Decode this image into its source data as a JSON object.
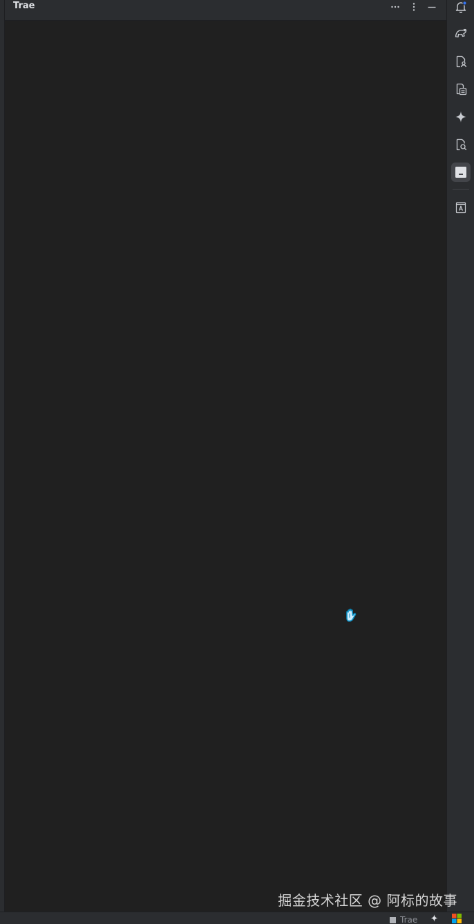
{
  "panel": {
    "title": "Trae",
    "actions": {
      "more": "⋯",
      "options": "⋮",
      "minimize": "—"
    }
  },
  "right_stripe": {
    "items": [
      {
        "icon": "notifications-bell-icon",
        "badge": true
      },
      {
        "icon": "ai-brain-icon"
      },
      {
        "icon": "user-document-icon"
      },
      {
        "icon": "clipboard-document-icon"
      },
      {
        "icon": "sparkle-ai-icon"
      },
      {
        "icon": "document-search-icon"
      },
      {
        "icon": "terminal-panel-icon",
        "active": true
      },
      {
        "icon": "font-book-icon"
      }
    ],
    "accent_color": "#3574f0"
  },
  "status_bar": {
    "trae_label": "Trae"
  },
  "watermark": {
    "text": "掘金技术社区 @ 阿标的故事"
  },
  "colors": {
    "panel_background": "#202020",
    "chrome_background": "#2b2d30",
    "icon_color": "#c9ccd1"
  }
}
